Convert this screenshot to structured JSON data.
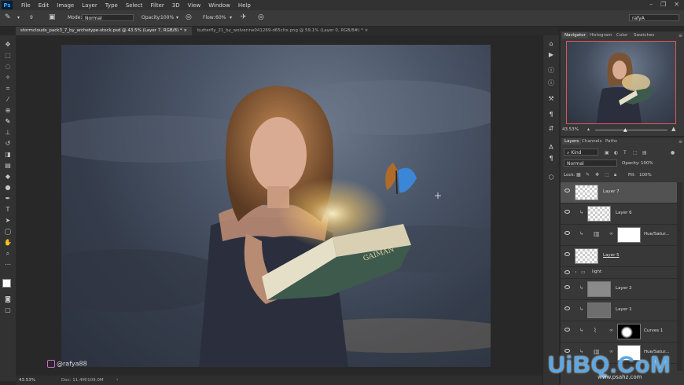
{
  "app": {
    "logo": "Ps"
  },
  "menu": [
    "File",
    "Edit",
    "Image",
    "Layer",
    "Type",
    "Select",
    "Filter",
    "3D",
    "View",
    "Window",
    "Help"
  ],
  "options": {
    "mode_label": "Mode:",
    "mode_value": "Normal",
    "opacity_label": "Opacity:",
    "opacity_value": "100%",
    "flow_label": "Flow:",
    "flow_value": "60%",
    "brush_size": "9",
    "workspace": "rafyA"
  },
  "tabs": [
    {
      "label": "stormclouds_pack3_7_by_archetype-stock.psd @ 43.5% (Layer 7, RGB/8) *",
      "close": "×"
    },
    {
      "label": "butterfly_21_by_wolverine041269-d65cltx.png @ 59.1% (Layer 0, RGB/8#) *",
      "close": "×"
    }
  ],
  "navigator": {
    "tabs": [
      "Navigator",
      "Histogram",
      "Color",
      "Swatches"
    ],
    "zoom": "43.53%"
  },
  "layers_panel": {
    "tabs": [
      "Layers",
      "Channels",
      "Paths"
    ],
    "filter_kind": "Kind",
    "blend_mode": "Normal",
    "opacity_label": "Opacity:",
    "opacity_value": "100%",
    "lock_label": "Lock:",
    "fill_label": "Fill:",
    "fill_value": "100%",
    "layers": [
      {
        "name": "Layer 7",
        "selected": true
      },
      {
        "name": "Layer 6",
        "selected": false
      },
      {
        "name": "Hue/Satur...",
        "selected": false
      },
      {
        "name": "Layer 5",
        "selected": false
      },
      {
        "name": "light",
        "selected": false
      },
      {
        "name": "Layer 2",
        "selected": false
      },
      {
        "name": "Layer 1",
        "selected": false
      },
      {
        "name": "Curves 1",
        "selected": false
      },
      {
        "name": "Hue/Satur...",
        "selected": false
      }
    ]
  },
  "status": {
    "zoom": "43.53%",
    "doc": "Doc: 11.4M/109.0M"
  },
  "social_handle": "@rafya88",
  "book_text": "GAIMAN",
  "watermark": {
    "main": "UiBQ.CoM",
    "sub": "www.psahz.com"
  },
  "colors": {
    "accent": "#31a8ff",
    "nav_frame": "#e0565a",
    "watermark": "#5aa9e6"
  }
}
